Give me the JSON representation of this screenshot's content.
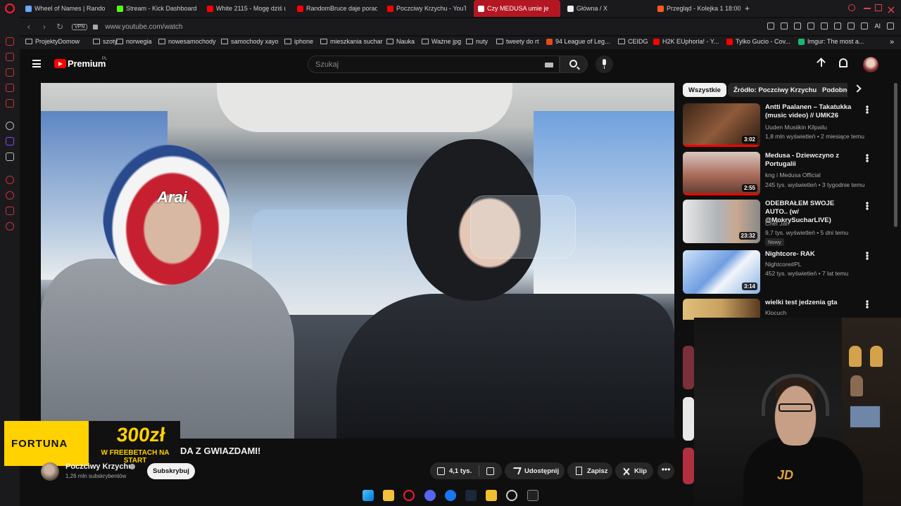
{
  "browser": {
    "tabs": [
      {
        "label": "Wheel of Names | Rando",
        "color": "#6aa9ff"
      },
      {
        "label": "Stream - Kick Dashboard",
        "color": "#53fc18"
      },
      {
        "label": "White 2115 - Mogę dziś u",
        "color": "#ff0000"
      },
      {
        "label": "RandomBruce daje porady",
        "color": "#ff0000"
      },
      {
        "label": "Poczciwy Krzychu - YouT",
        "color": "#ff0000"
      },
      {
        "label": "Czy MEDUSA umie je",
        "color": "#ff0000",
        "active": true
      },
      {
        "label": "Główna / X",
        "color": "#ffffff"
      },
      {
        "label": "Przegląd - Kolejka 1 18:00",
        "color": "#ff5a1f"
      }
    ],
    "new_tab": "+",
    "address": {
      "vpn": "VPN",
      "url": "www.youtube.com/watch",
      "ai": "AI"
    },
    "bookmarks": [
      {
        "label": "ProjektyDomow",
        "type": "folder"
      },
      {
        "label": "szoty",
        "type": "folder"
      },
      {
        "label": "norwegia",
        "type": "folder"
      },
      {
        "label": "nowesamochody",
        "type": "folder"
      },
      {
        "label": "samochody xayo",
        "type": "folder"
      },
      {
        "label": "iphone",
        "type": "folder"
      },
      {
        "label": "mieszkania suchar",
        "type": "folder"
      },
      {
        "label": "Nauka",
        "type": "folder"
      },
      {
        "label": "Ważne jpg",
        "type": "folder"
      },
      {
        "label": "nuty",
        "type": "folder"
      },
      {
        "label": "tweety do rt",
        "type": "folder"
      },
      {
        "label": "94 League of Leg...",
        "type": "site",
        "color": "#e64a19"
      },
      {
        "label": "CEIDG",
        "type": "folder"
      },
      {
        "label": "H2K EUphoria! - Y...",
        "type": "site",
        "color": "#ff0000"
      },
      {
        "label": "Tylko Gucio - Cov...",
        "type": "site",
        "color": "#ff0000"
      },
      {
        "label": "Imgur: The most a...",
        "type": "site",
        "color": "#1bb76e"
      }
    ]
  },
  "youtube": {
    "brand": "Premium",
    "country": "PL",
    "search_placeholder": "Szukaj",
    "video": {
      "helmet_text": "Arai",
      "title_fragment": "DA Z GWIAZDAMI!",
      "channel": "Poczciwy Krzychu",
      "subscribers": "1,26 mln subskrybentów",
      "subscribe_label": "Subskrybuj",
      "likes": "4,1 tys.",
      "share_label": "Udostępnij",
      "save_label": "Zapisz",
      "clip_label": "Klip",
      "more_label": "•••"
    },
    "ad": {
      "brand": "FORTUNA",
      "amount": "300zł",
      "subtitle": "W FREEBETACH NA START"
    },
    "chips": [
      "Wszystkie",
      "Źródło: Poczciwy Krzychu",
      "Podobne"
    ],
    "recommendations": [
      {
        "title": "Antti Paalanen – Takatukka (music video) // UMK26",
        "channel": "Uuden Musiikin Kilpailu",
        "meta": "1,8 mln wyświetleń • 2 miesiące temu",
        "duration": "3:02",
        "thumb": "#7a4a30"
      },
      {
        "title": "Medusa - Dziewczyno z Portugalii",
        "channel": "kng  i Medusa Official",
        "meta": "245 tys. wyświetleń • 3 tygodnie temu",
        "duration": "2:55",
        "thumb": "#a86a58"
      },
      {
        "title": "ODEBRAŁEM SWOJE AUTO.. (w/ @MokrySucharLIVE)",
        "channel": "Chef Jan",
        "meta": "9,7 tys. wyświetleń • 5 dni temu",
        "duration": "23:32",
        "badge": "Nowy",
        "thumb": "#9aa0a6"
      },
      {
        "title": "Nightcore- RAK",
        "channel": "Nightcore#PL",
        "meta": "452 tys. wyświetleń • 7 lat temu",
        "duration": "3:14",
        "thumb": "#8fb6e8"
      },
      {
        "title": "wielki test jedzenia gta",
        "channel": "Klocuch",
        "meta": "",
        "duration": "",
        "thumb": "#c8a060"
      }
    ]
  },
  "webcam": {
    "shirt_logo": "JD"
  }
}
